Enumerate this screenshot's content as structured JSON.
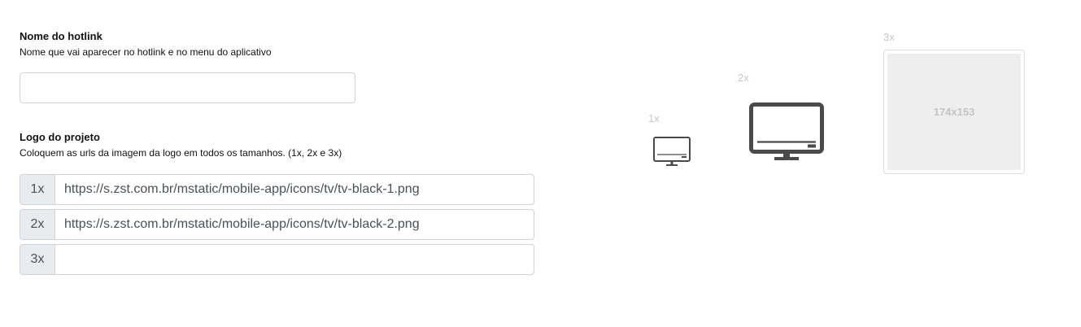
{
  "hotlink_name": {
    "title": "Nome do hotlink",
    "help": "Nome que vai aparecer no hotlink e no menu do aplicativo",
    "value": ""
  },
  "logo": {
    "title": "Logo do projeto",
    "help": "Coloquem as urls da imagem da logo em todos os tamanhos. (1x, 2x e 3x)",
    "urls": [
      {
        "prefix": "1x",
        "value": "https://s.zst.com.br/mstatic/mobile-app/icons/tv/tv-black-1.png"
      },
      {
        "prefix": "2x",
        "value": "https://s.zst.com.br/mstatic/mobile-app/icons/tv/tv-black-2.png"
      },
      {
        "prefix": "3x",
        "value": ""
      }
    ]
  },
  "previews": {
    "label_1x": "1x",
    "label_2x": "2x",
    "label_3x": "3x",
    "placeholder_text": "174x153",
    "icon_1x": "tv-icon",
    "icon_2x": "tv-icon",
    "icon_color": "#4a4a4a"
  }
}
